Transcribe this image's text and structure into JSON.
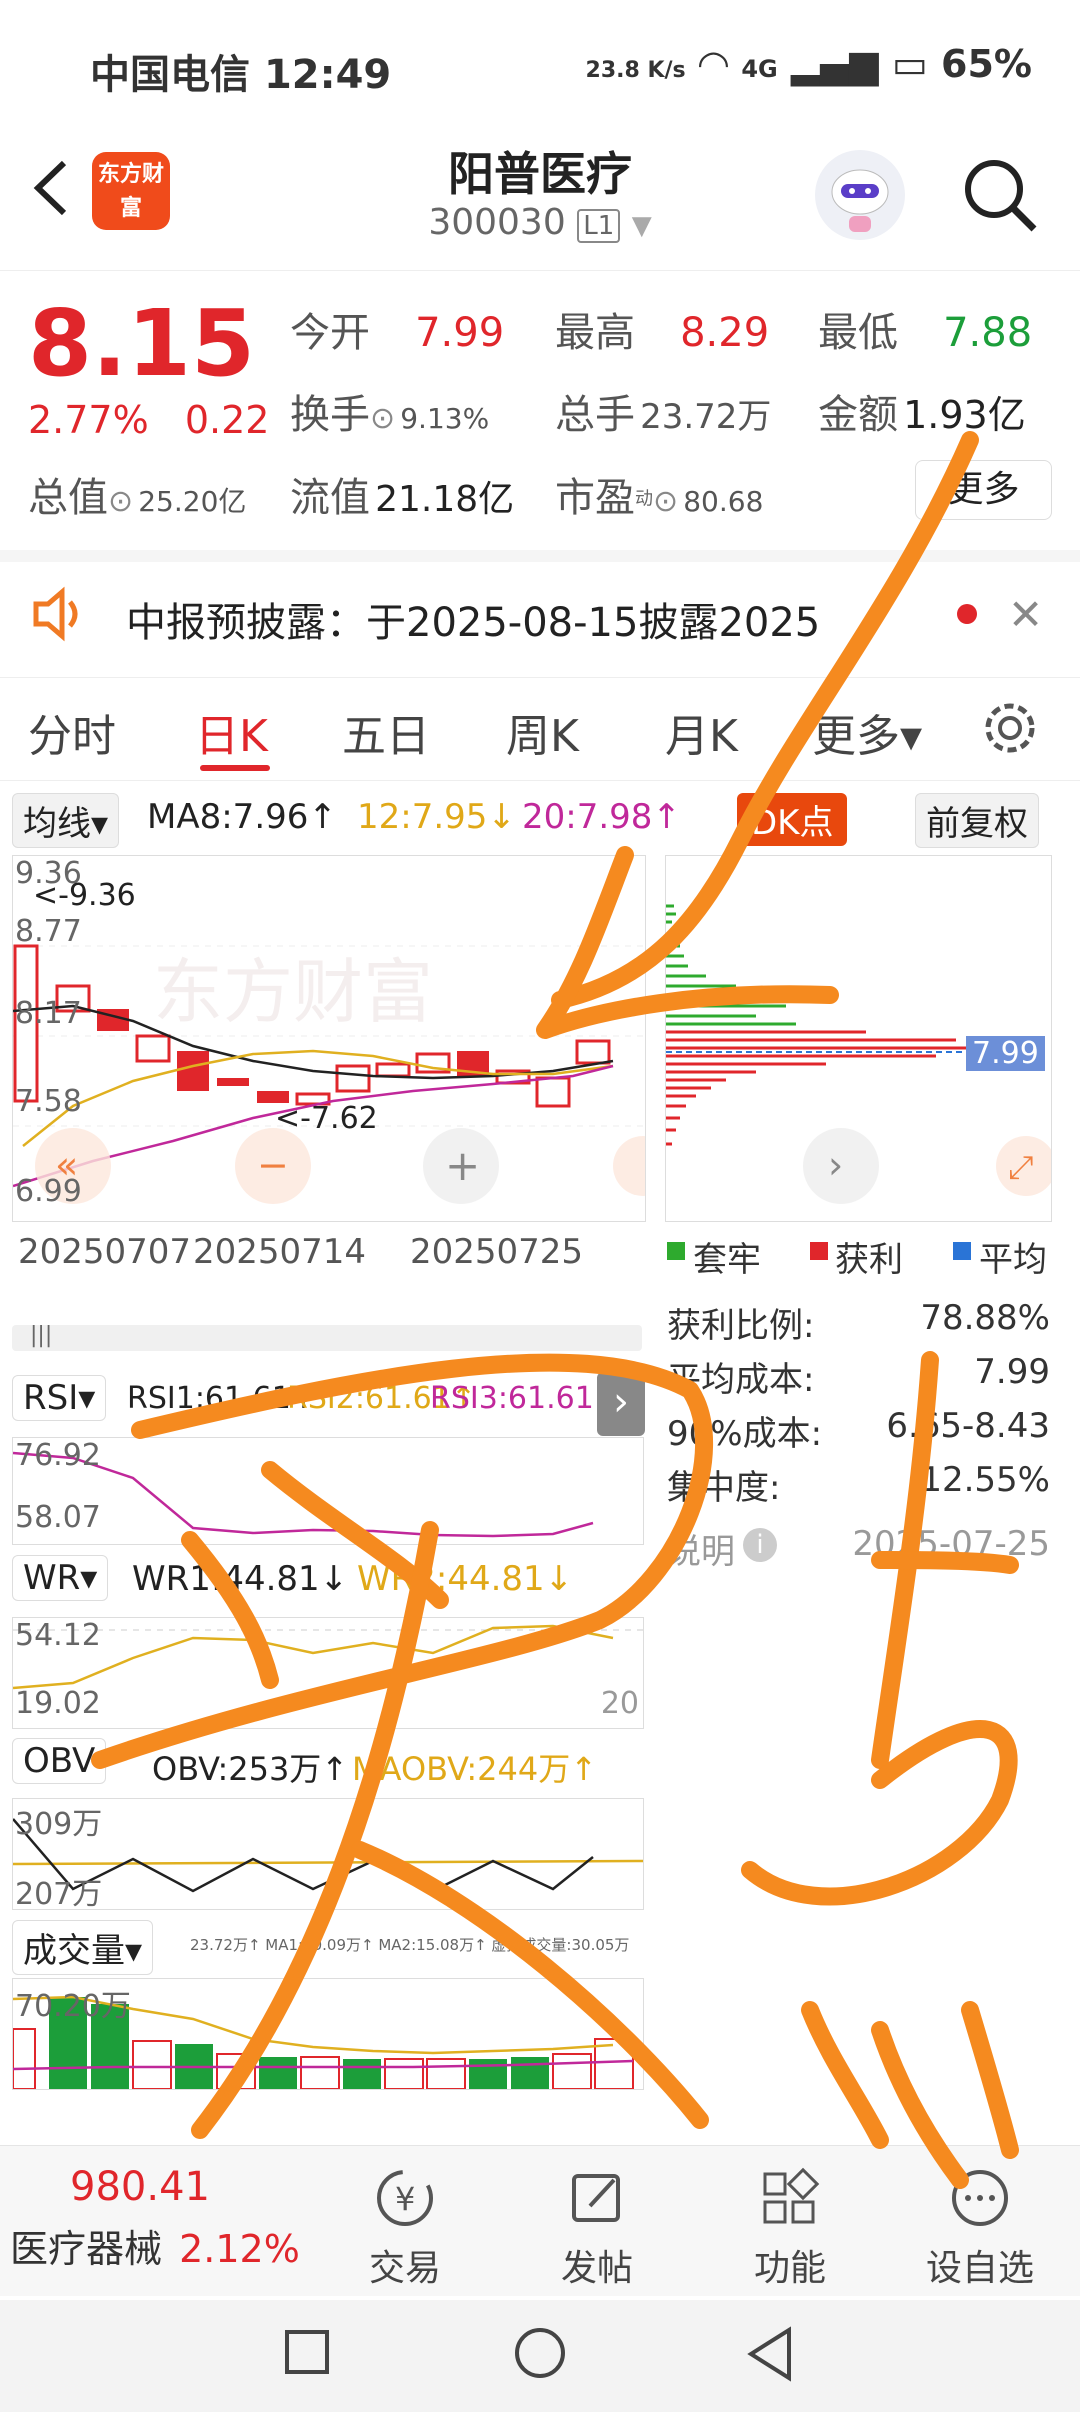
{
  "status_bar": {
    "carrier": "中国电信",
    "time": "12:49",
    "net_speed": "23.8 K/s",
    "network": "4G",
    "battery": "65%"
  },
  "header": {
    "back_icon": "chevron-left-icon",
    "logo_text": "东方财富",
    "stock_name": "阳普医疗",
    "stock_code": "300030",
    "level_badge": "L1",
    "search_icon": "search-icon"
  },
  "quote": {
    "price": "8.15",
    "change_pct": "2.77%",
    "change_amt": "0.22",
    "open_label": "今开",
    "open_value": "7.99",
    "high_label": "最高",
    "high_value": "8.29",
    "low_label": "最低",
    "low_value": "7.88",
    "turnover_label": "换手",
    "turnover_value": "9.13%",
    "volume_label": "总手",
    "volume_value": "23.72万",
    "amount_label": "金额",
    "amount_value": "1.93亿",
    "mktcap_label": "总值",
    "mktcap_value": "25.20亿",
    "float_label": "流值",
    "float_value": "21.18亿",
    "pe_label": "市盈",
    "pe_sup": "动",
    "pe_value": "80.68",
    "more_button": "更多"
  },
  "notice": {
    "text": "中报预披露：于2025-08-15披露2025"
  },
  "tabs": [
    "分时",
    "日K",
    "五日",
    "周K",
    "月K",
    "更多▾"
  ],
  "active_tab": "日K",
  "ma_bar": {
    "selector": "均线▾",
    "ma8": "MA8:7.96↑",
    "ma12": "12:7.95↓",
    "ma20": "20:7.98↑",
    "dk_button": "DK点",
    "restore_button": "前复权"
  },
  "kline": {
    "y_labels": [
      "9.36",
      "8.77",
      "8.17",
      "7.58",
      "6.99"
    ],
    "high_marker": "<-9.36",
    "low_marker": "<-7.62",
    "x_labels": [
      "20250707",
      "20250714",
      "20250725"
    ],
    "chip_price": "7.99"
  },
  "chips": {
    "legend": [
      "套牢",
      "获利",
      "平均"
    ],
    "legend_colors": [
      "#2eaa2e",
      "#e0262b",
      "#2a74d6"
    ],
    "profit_ratio_label": "获利比例:",
    "profit_ratio": "78.88%",
    "avg_cost_label": "平均成本:",
    "avg_cost": "7.99",
    "cost90_label": "90%成本:",
    "cost90": "6.65-8.43",
    "concentration_label": "集中度:",
    "concentration": "12.55%",
    "note_label": "说明",
    "date": "2025-07-25"
  },
  "rsi": {
    "selector": "RSI▾",
    "rsi1": "RSI1:61.61↑",
    "rsi2": "RSI2:61.61↑",
    "rsi3": "RSI3:61.61↑",
    "y_labels": [
      "76.92",
      "58.07"
    ]
  },
  "wr": {
    "selector": "WR▾",
    "wr1": "WR1:44.81↓",
    "wr2": "WR2:44.81↓",
    "y_labels": [
      "54.12",
      "19.02"
    ],
    "right_label": "20"
  },
  "obv": {
    "selector": "OBV",
    "obv": "OBV:253万↑",
    "maobv": "MAOBV:244万↑",
    "y_labels": [
      "309万",
      "207万"
    ]
  },
  "volume": {
    "selector": "成交量▾",
    "info": "23.72万↑ MA1:20.09万↑ MA2:15.08万↑ 虚拟成交量:30.05万",
    "y_label": "70.20万"
  },
  "bottom_nav": {
    "index_value": "980.41",
    "index_name": "医疗器械",
    "index_change": "2.12%",
    "items": [
      "交易",
      "发帖",
      "功能",
      "设自选"
    ]
  }
}
